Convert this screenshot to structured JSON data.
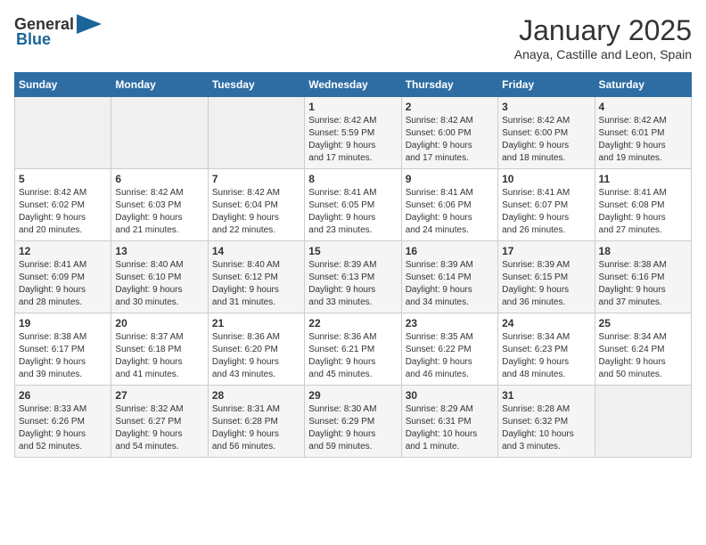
{
  "header": {
    "logo_general": "General",
    "logo_blue": "Blue",
    "month_title": "January 2025",
    "location": "Anaya, Castille and Leon, Spain"
  },
  "weekdays": [
    "Sunday",
    "Monday",
    "Tuesday",
    "Wednesday",
    "Thursday",
    "Friday",
    "Saturday"
  ],
  "weeks": [
    [
      {
        "day": "",
        "info": ""
      },
      {
        "day": "",
        "info": ""
      },
      {
        "day": "",
        "info": ""
      },
      {
        "day": "1",
        "info": "Sunrise: 8:42 AM\nSunset: 5:59 PM\nDaylight: 9 hours\nand 17 minutes."
      },
      {
        "day": "2",
        "info": "Sunrise: 8:42 AM\nSunset: 6:00 PM\nDaylight: 9 hours\nand 17 minutes."
      },
      {
        "day": "3",
        "info": "Sunrise: 8:42 AM\nSunset: 6:00 PM\nDaylight: 9 hours\nand 18 minutes."
      },
      {
        "day": "4",
        "info": "Sunrise: 8:42 AM\nSunset: 6:01 PM\nDaylight: 9 hours\nand 19 minutes."
      }
    ],
    [
      {
        "day": "5",
        "info": "Sunrise: 8:42 AM\nSunset: 6:02 PM\nDaylight: 9 hours\nand 20 minutes."
      },
      {
        "day": "6",
        "info": "Sunrise: 8:42 AM\nSunset: 6:03 PM\nDaylight: 9 hours\nand 21 minutes."
      },
      {
        "day": "7",
        "info": "Sunrise: 8:42 AM\nSunset: 6:04 PM\nDaylight: 9 hours\nand 22 minutes."
      },
      {
        "day": "8",
        "info": "Sunrise: 8:41 AM\nSunset: 6:05 PM\nDaylight: 9 hours\nand 23 minutes."
      },
      {
        "day": "9",
        "info": "Sunrise: 8:41 AM\nSunset: 6:06 PM\nDaylight: 9 hours\nand 24 minutes."
      },
      {
        "day": "10",
        "info": "Sunrise: 8:41 AM\nSunset: 6:07 PM\nDaylight: 9 hours\nand 26 minutes."
      },
      {
        "day": "11",
        "info": "Sunrise: 8:41 AM\nSunset: 6:08 PM\nDaylight: 9 hours\nand 27 minutes."
      }
    ],
    [
      {
        "day": "12",
        "info": "Sunrise: 8:41 AM\nSunset: 6:09 PM\nDaylight: 9 hours\nand 28 minutes."
      },
      {
        "day": "13",
        "info": "Sunrise: 8:40 AM\nSunset: 6:10 PM\nDaylight: 9 hours\nand 30 minutes."
      },
      {
        "day": "14",
        "info": "Sunrise: 8:40 AM\nSunset: 6:12 PM\nDaylight: 9 hours\nand 31 minutes."
      },
      {
        "day": "15",
        "info": "Sunrise: 8:39 AM\nSunset: 6:13 PM\nDaylight: 9 hours\nand 33 minutes."
      },
      {
        "day": "16",
        "info": "Sunrise: 8:39 AM\nSunset: 6:14 PM\nDaylight: 9 hours\nand 34 minutes."
      },
      {
        "day": "17",
        "info": "Sunrise: 8:39 AM\nSunset: 6:15 PM\nDaylight: 9 hours\nand 36 minutes."
      },
      {
        "day": "18",
        "info": "Sunrise: 8:38 AM\nSunset: 6:16 PM\nDaylight: 9 hours\nand 37 minutes."
      }
    ],
    [
      {
        "day": "19",
        "info": "Sunrise: 8:38 AM\nSunset: 6:17 PM\nDaylight: 9 hours\nand 39 minutes."
      },
      {
        "day": "20",
        "info": "Sunrise: 8:37 AM\nSunset: 6:18 PM\nDaylight: 9 hours\nand 41 minutes."
      },
      {
        "day": "21",
        "info": "Sunrise: 8:36 AM\nSunset: 6:20 PM\nDaylight: 9 hours\nand 43 minutes."
      },
      {
        "day": "22",
        "info": "Sunrise: 8:36 AM\nSunset: 6:21 PM\nDaylight: 9 hours\nand 45 minutes."
      },
      {
        "day": "23",
        "info": "Sunrise: 8:35 AM\nSunset: 6:22 PM\nDaylight: 9 hours\nand 46 minutes."
      },
      {
        "day": "24",
        "info": "Sunrise: 8:34 AM\nSunset: 6:23 PM\nDaylight: 9 hours\nand 48 minutes."
      },
      {
        "day": "25",
        "info": "Sunrise: 8:34 AM\nSunset: 6:24 PM\nDaylight: 9 hours\nand 50 minutes."
      }
    ],
    [
      {
        "day": "26",
        "info": "Sunrise: 8:33 AM\nSunset: 6:26 PM\nDaylight: 9 hours\nand 52 minutes."
      },
      {
        "day": "27",
        "info": "Sunrise: 8:32 AM\nSunset: 6:27 PM\nDaylight: 9 hours\nand 54 minutes."
      },
      {
        "day": "28",
        "info": "Sunrise: 8:31 AM\nSunset: 6:28 PM\nDaylight: 9 hours\nand 56 minutes."
      },
      {
        "day": "29",
        "info": "Sunrise: 8:30 AM\nSunset: 6:29 PM\nDaylight: 9 hours\nand 59 minutes."
      },
      {
        "day": "30",
        "info": "Sunrise: 8:29 AM\nSunset: 6:31 PM\nDaylight: 10 hours\nand 1 minute."
      },
      {
        "day": "31",
        "info": "Sunrise: 8:28 AM\nSunset: 6:32 PM\nDaylight: 10 hours\nand 3 minutes."
      },
      {
        "day": "",
        "info": ""
      }
    ]
  ]
}
